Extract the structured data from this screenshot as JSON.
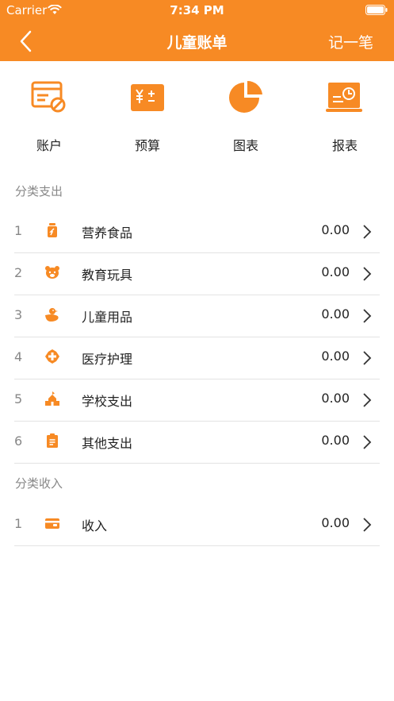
{
  "status": {
    "carrier": "Carrier",
    "time": "7:34 PM"
  },
  "nav": {
    "title": "儿童账单",
    "record_label": "记一笔"
  },
  "actions": [
    {
      "label": "账户",
      "icon": "account-card-icon"
    },
    {
      "label": "预算",
      "icon": "budget-icon"
    },
    {
      "label": "图表",
      "icon": "pie-chart-icon"
    },
    {
      "label": "报表",
      "icon": "report-icon"
    }
  ],
  "expense": {
    "title": "分类支出",
    "items": [
      {
        "index": "1",
        "name": "营养食品",
        "amount": "0.00",
        "icon": "bottle-icon"
      },
      {
        "index": "2",
        "name": "教育玩具",
        "amount": "0.00",
        "icon": "bear-icon"
      },
      {
        "index": "3",
        "name": "儿童用品",
        "amount": "0.00",
        "icon": "duck-icon"
      },
      {
        "index": "4",
        "name": "医疗护理",
        "amount": "0.00",
        "icon": "medical-cross-icon"
      },
      {
        "index": "5",
        "name": "学校支出",
        "amount": "0.00",
        "icon": "school-icon"
      },
      {
        "index": "6",
        "name": "其他支出",
        "amount": "0.00",
        "icon": "clipboard-icon"
      }
    ]
  },
  "income": {
    "title": "分类收入",
    "items": [
      {
        "index": "1",
        "name": "收入",
        "amount": "0.00",
        "icon": "card-icon"
      }
    ]
  },
  "colors": {
    "accent": "#f78a24",
    "text": "#222222",
    "muted": "#888888"
  }
}
